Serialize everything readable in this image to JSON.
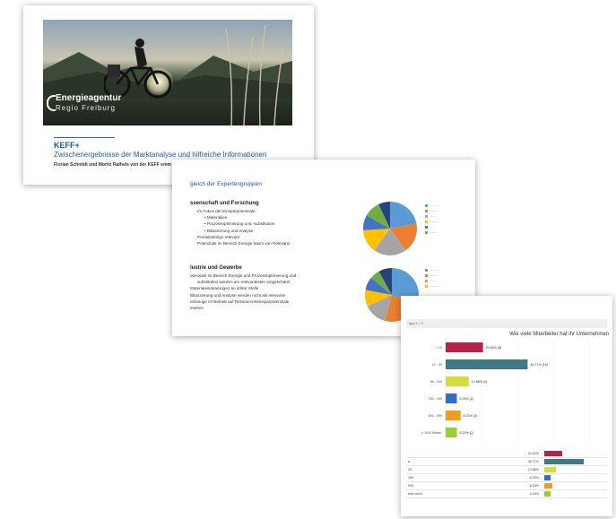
{
  "slide1": {
    "logo_line1": "Energieagentur",
    "logo_line2": "Regio Freiburg",
    "title": "KEFF+",
    "subtitle": "Zwischenergebnisse der Marktanalyse und hilfreiche Informationen",
    "authors": "Florian Schmidt und Moritz Rathels von der KEFF emm"
  },
  "slide2": {
    "header": "gleich der Expertengruppen",
    "group1": {
      "heading": "ssenschaft und Forschung",
      "lines": [
        "Im Fokus der Einsparpotenziale",
        "Materialien",
        "Prozessoptimierung und -substitution",
        "Bilanzierung und Analyse",
        "Produktdesign relevant",
        "Potenziale im Bereich Energie kaum von Relevanz"
      ]
    },
    "group2": {
      "heading": "lustrie und Gewerbe",
      "lines": [
        "otenziale im Bereich Energie und Prozessoptimierung und -",
        "substitution werden am relevantesten eingeschätzt",
        "Materialeinsparungen an dritter Stelle",
        "Bilanzierung und Analyse werden nicht als relevante",
        "erkzeuge im Betrieb auf Ressourceneinsparpotenziale",
        "esehen"
      ]
    },
    "pie1_colors": [
      "#5b9bd5",
      "#ed7d31",
      "#a5a5a5",
      "#ffc000",
      "#4472c4",
      "#70ad47",
      "#264478"
    ],
    "pie1_values": [
      22,
      18,
      20,
      14,
      9,
      10,
      7
    ],
    "pie2_colors": [
      "#5b9bd5",
      "#ed7d31",
      "#a5a5a5",
      "#ffc000",
      "#4472c4",
      "#70ad47",
      "#264478"
    ],
    "pie2_values": [
      30,
      24,
      14,
      10,
      8,
      6,
      8
    ]
  },
  "slide3": {
    "topbar": "app   1 / 3",
    "title": "Wie viele Mitarbeiter hat ihr Unternehmen",
    "chart_data": {
      "type": "bar",
      "categories": [
        "< 10",
        "10 - 49",
        "50 - 249",
        "250 - 499",
        "500 - 999",
        "≥ 1000 Mitarb."
      ],
      "values": [
        20.83,
        45.71,
        12.88,
        6.25,
        8.33,
        6.25
      ],
      "labels": [
        "20.83% (5)",
        "45.71% (16)",
        "12.88% (4)",
        "6.25% (2)",
        "8.33% (3)",
        "6.25% (2)"
      ],
      "colors": [
        "#b5234b",
        "#3f7a82",
        "#d4dd3c",
        "#2f6fd1",
        "#f29d1a",
        "#9acd32"
      ],
      "xlim": [
        0,
        100
      ]
    },
    "table": {
      "rows": [
        {
          "label": "",
          "value": "20.83%"
        },
        {
          "label": "a",
          "value": "45.71%"
        },
        {
          "label": "49",
          "value": "12.88%"
        },
        {
          "label": "499",
          "value": "6.25%"
        },
        {
          "label": "999",
          "value": "8.33%"
        },
        {
          "label": "elter mehr",
          "value": "6.25%"
        }
      ]
    }
  }
}
